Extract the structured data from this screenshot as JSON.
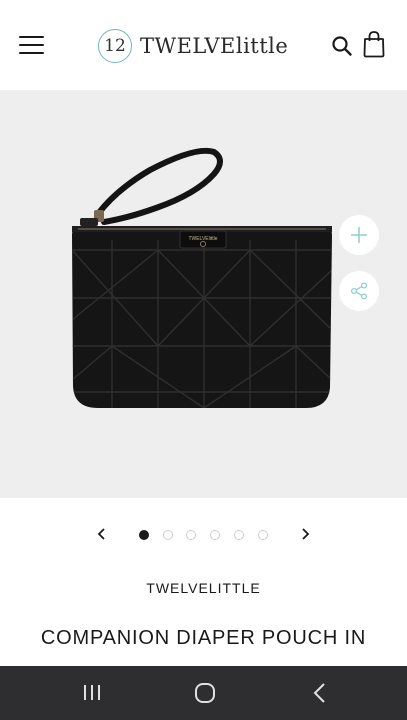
{
  "header": {
    "menu_icon": "hamburger-menu-icon",
    "logo_number": "12",
    "logo_text_bold": "TWELVE",
    "logo_text_light": "little",
    "search_icon": "search-icon",
    "bag_icon": "shopping-bag-icon"
  },
  "hero": {
    "image_alt": "black quilted companion diaper pouch with wrist strap",
    "plus_icon": "plus-icon",
    "share_icon": "share-icon",
    "pouch_tag": "TWELVElittle",
    "pouch_tag_number": "12"
  },
  "carousel": {
    "prev_icon": "chevron-left-icon",
    "next_icon": "chevron-right-icon",
    "slide_count": 6,
    "active_index": 0
  },
  "product": {
    "brand": "TWELVELITTLE",
    "title": "COMPANION DIAPER POUCH IN"
  },
  "system_nav": {
    "recents_icon": "recent-apps-icon",
    "home_icon": "home-circle-icon",
    "back_icon": "back-chevron-icon"
  },
  "colors": {
    "accent": "#6fb9b3",
    "hero_bg": "#eeeeee",
    "nav_bg": "#2e2e30"
  }
}
